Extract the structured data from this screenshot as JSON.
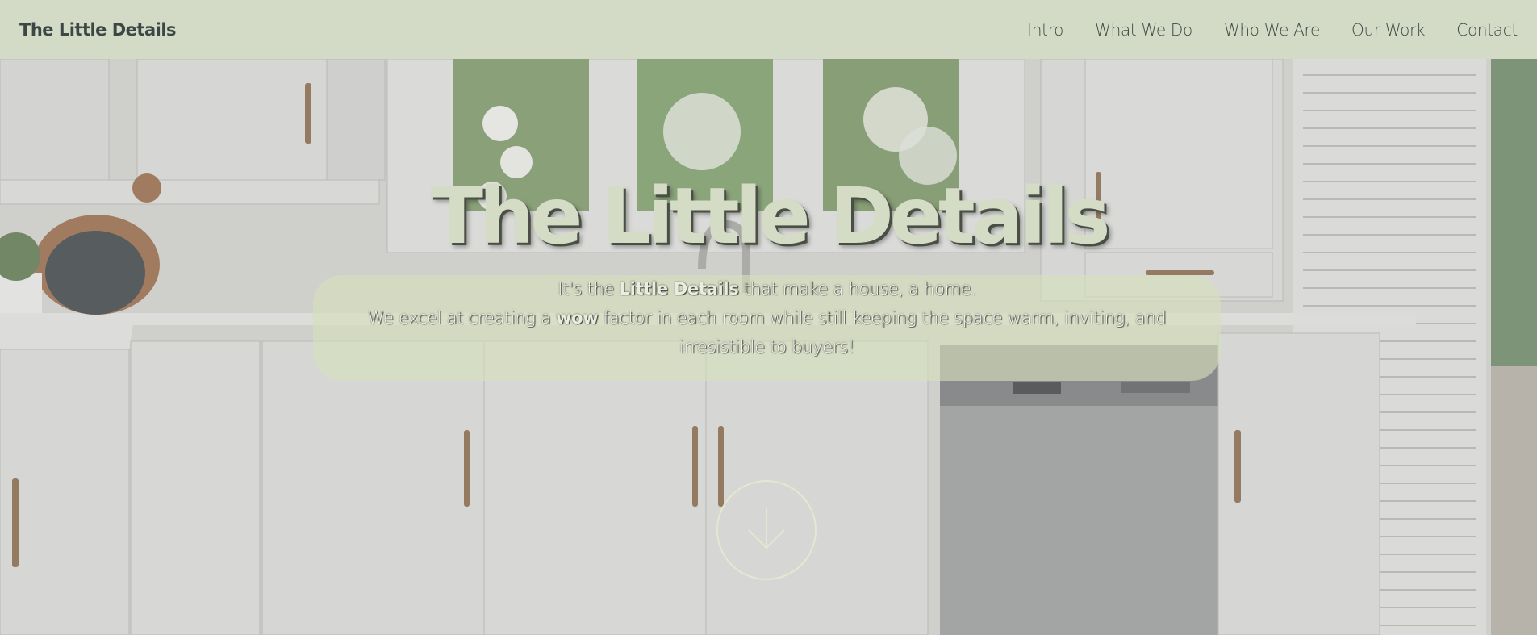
{
  "header": {
    "brand": "The Little Details",
    "nav": [
      {
        "label": "Intro"
      },
      {
        "label": "What We Do"
      },
      {
        "label": "Who We Are"
      },
      {
        "label": "Our Work"
      },
      {
        "label": "Contact"
      }
    ]
  },
  "hero": {
    "title": "The Little Details",
    "tagline": {
      "pre": "It's the ",
      "bold": "Little Details",
      "post": " that make a house, a home."
    },
    "description": {
      "pre": "We excel at creating a ",
      "bold": "wow",
      "post": " factor in each room while still keeping the space warm, inviting, and",
      "line2": "irresistible to buyers!"
    },
    "scroll_icon": "arrow-down-icon"
  },
  "colors": {
    "nav_bg": "#d3dbc6",
    "brand_text": "#3c4645",
    "hero_title": "#d5dcc5",
    "panel_bg": "#d6e0bc"
  }
}
